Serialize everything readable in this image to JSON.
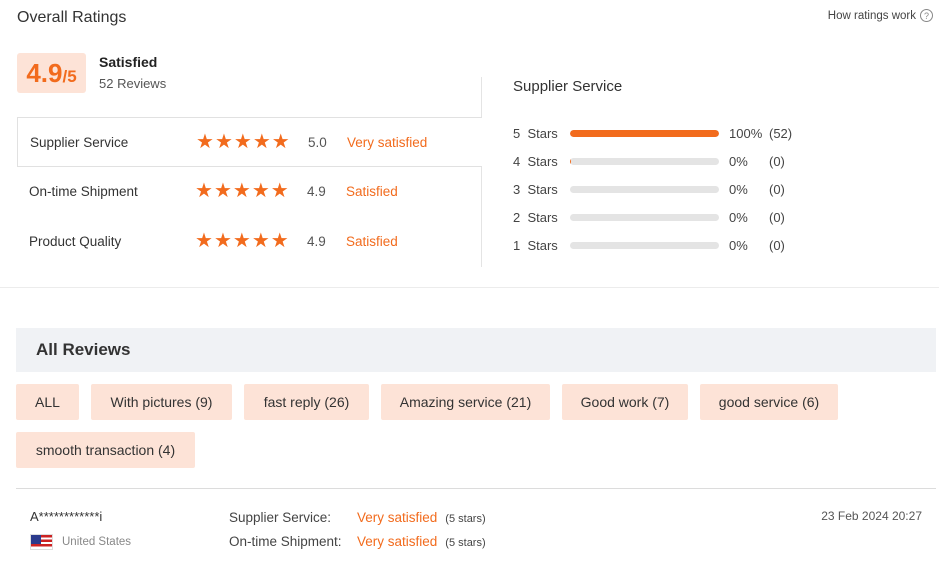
{
  "header": {
    "title": "Overall Ratings",
    "how_ratings_work": "How ratings work",
    "help_glyph": "?"
  },
  "score": {
    "value": "4.9",
    "out_of": "/5",
    "label": "Satisfied",
    "reviews": "52 Reviews"
  },
  "ratings": [
    {
      "name": "Supplier Service",
      "score": "5.0",
      "text": "Very satisfied",
      "stars": 5
    },
    {
      "name": "On-time Shipment",
      "score": "4.9",
      "text": "Satisfied",
      "stars": 4.9
    },
    {
      "name": "Product Quality",
      "score": "4.9",
      "text": "Satisfied",
      "stars": 4.9
    }
  ],
  "supplier_service": {
    "title": "Supplier Service",
    "distribution": [
      {
        "label": "5  Stars",
        "percent": "100%",
        "count": "(52)",
        "fill": 1.0
      },
      {
        "label": "4  Stars",
        "percent": "0%",
        "count": "(0)",
        "fill": 0.01
      },
      {
        "label": "3  Stars",
        "percent": "0%",
        "count": "(0)",
        "fill": 0
      },
      {
        "label": "2  Stars",
        "percent": "0%",
        "count": "(0)",
        "fill": 0
      },
      {
        "label": "1  Stars",
        "percent": "0%",
        "count": "(0)",
        "fill": 0
      }
    ]
  },
  "all_reviews": {
    "title": "All Reviews",
    "chips": [
      "ALL",
      "With pictures (9)",
      "fast reply (26)",
      "Amazing service (21)",
      "Good work (7)",
      "good service (6)",
      "smooth transaction (4)"
    ]
  },
  "review": {
    "reviewer": "A************i",
    "country": "United States",
    "flag_icon": "us-flag-icon",
    "date": "23 Feb 2024 20:27",
    "lines": [
      {
        "key": "Supplier Service:",
        "value": "Very satisfied",
        "stars": "(5 stars)"
      },
      {
        "key": "On-time Shipment:",
        "value": "Very satisfied",
        "stars": "(5 stars)"
      }
    ]
  },
  "colors": {
    "accent": "#f26b1d",
    "chip_bg": "#fde3d7",
    "section_bg": "#f0f2f5"
  }
}
